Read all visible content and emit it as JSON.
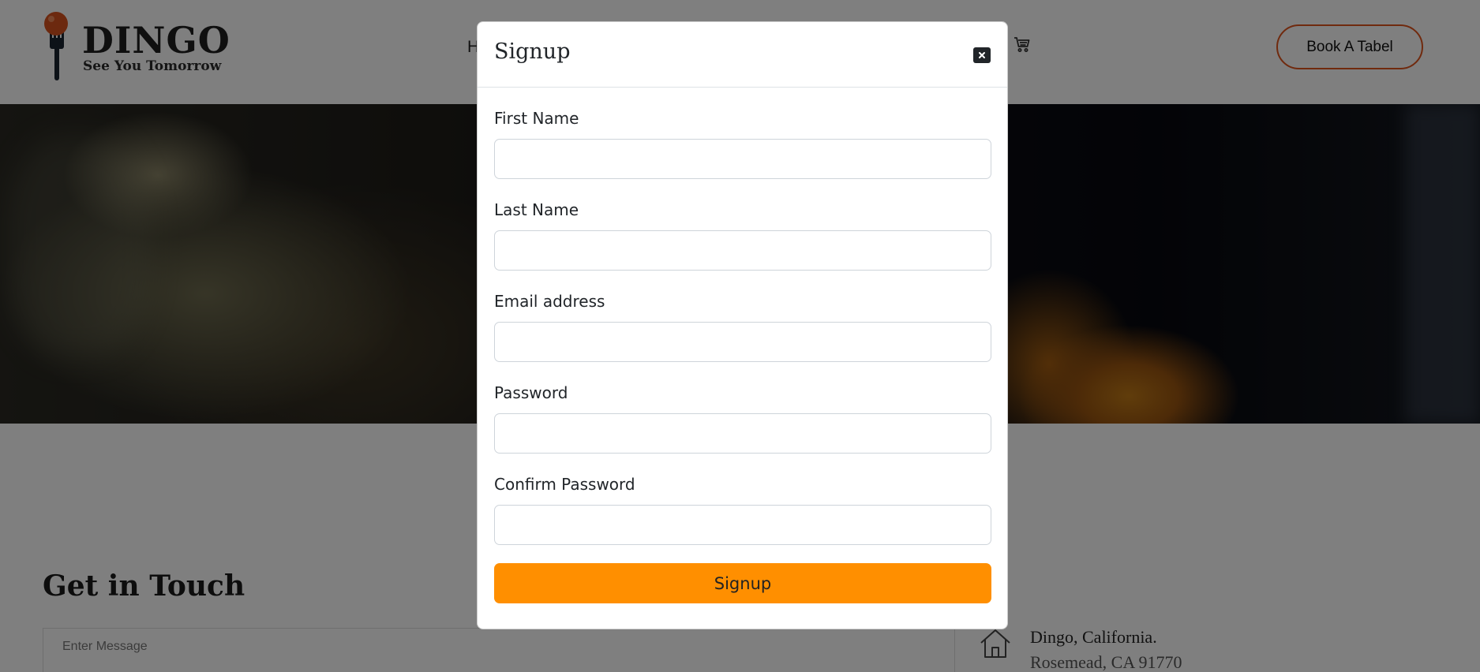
{
  "header": {
    "logo_name": "DINGO",
    "logo_tagline": "See You Tomorrow",
    "nav_first_char": "H",
    "cta_label": "Book A Tabel"
  },
  "contact": {
    "title": "Get in Touch",
    "message_placeholder": "Enter Message",
    "address_line1": "Dingo, California.",
    "address_line2": "Rosemead, CA 91770"
  },
  "modal": {
    "title": "Signup",
    "fields": [
      {
        "label": "First Name",
        "value": ""
      },
      {
        "label": "Last Name",
        "value": ""
      },
      {
        "label": "Email address",
        "value": ""
      },
      {
        "label": "Password",
        "value": ""
      },
      {
        "label": "Confirm Password",
        "value": ""
      }
    ],
    "submit_label": "Signup"
  },
  "colors": {
    "accent_orange": "#ff8f00",
    "cta_border": "#e0551c",
    "backdrop": "rgba(0,0,0,0.5)"
  },
  "icons": [
    "logo-fork-icon",
    "cart-icon",
    "close-icon",
    "home-icon"
  ]
}
